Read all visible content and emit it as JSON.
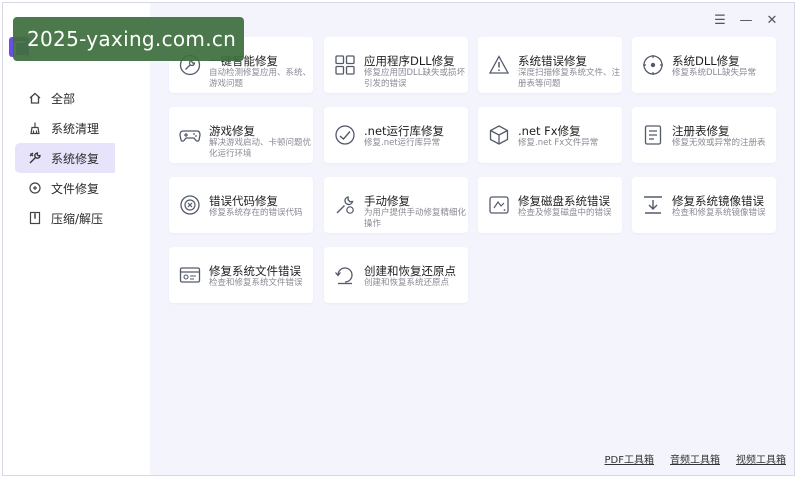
{
  "watermark": "2025-yaxing.com.cn",
  "window_controls": {
    "menu": "☰",
    "minimize": "—",
    "close": "✕"
  },
  "sidebar": {
    "items": [
      {
        "label": "全部",
        "icon": "home-icon"
      },
      {
        "label": "系统清理",
        "icon": "broom-icon"
      },
      {
        "label": "系统修复",
        "icon": "wrench-icon",
        "active": true
      },
      {
        "label": "文件修复",
        "icon": "file-repair-icon"
      },
      {
        "label": "压缩/解压",
        "icon": "zip-icon"
      }
    ]
  },
  "cards": [
    {
      "title": "一键智能修复",
      "desc": "自动检测修复应用、系统、游戏问题",
      "icon": "wrench-icon"
    },
    {
      "title": "应用程序DLL修复",
      "desc": "修复应用因DLL缺失或损坏引发的错误",
      "icon": "app-grid-icon"
    },
    {
      "title": "系统错误修复",
      "desc": "深度扫描修复系统文件、注册表等问题",
      "icon": "warning-icon"
    },
    {
      "title": "系统DLL修复",
      "desc": "修复系统DLL缺失异常",
      "icon": "target-icon"
    },
    {
      "title": "游戏修复",
      "desc": "解决游戏启动、卡顿问题优化运行环境",
      "icon": "gamepad-icon"
    },
    {
      "title": ".net运行库修复",
      "desc": "修复.net运行库异常",
      "icon": "net-library-icon"
    },
    {
      "title": ".net Fx修复",
      "desc": "修复.net Fx文件异常",
      "icon": "cube-icon"
    },
    {
      "title": "注册表修复",
      "desc": "修复无效或异常的注册表",
      "icon": "registry-icon"
    },
    {
      "title": "错误代码修复",
      "desc": "修复系统存在的错误代码",
      "icon": "error-code-icon"
    },
    {
      "title": "手动修复",
      "desc": "为用户提供手动修复精细化操作",
      "icon": "manual-tool-icon"
    },
    {
      "title": "修复磁盘系统错误",
      "desc": "检查及修复磁盘中的错误",
      "icon": "disk-icon"
    },
    {
      "title": "修复系统镜像错误",
      "desc": "检查和修复系统镜像错误",
      "icon": "image-download-icon"
    },
    {
      "title": "修复系统文件错误",
      "desc": "检查和修复系统文件错误",
      "icon": "system-file-icon"
    },
    {
      "title": "创建和恢复还原点",
      "desc": "创建和恢复系统还原点",
      "icon": "restore-point-icon"
    }
  ],
  "footer": {
    "links": [
      "PDF工具箱",
      "音频工具箱",
      "视频工具箱"
    ]
  },
  "colors": {
    "accent": "#6a4fe0",
    "active_bg": "#e6e3fb",
    "main_bg": "#f4f5fc",
    "icon_stroke": "#555a6b"
  }
}
